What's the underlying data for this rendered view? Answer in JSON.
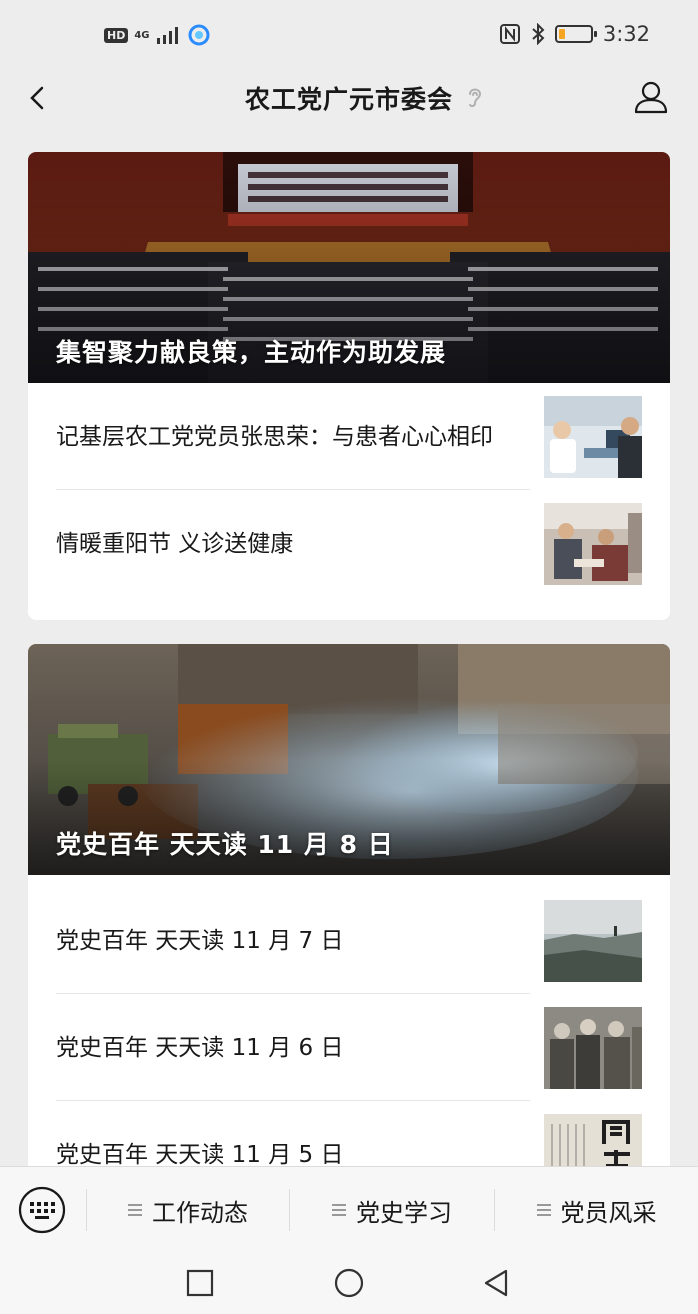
{
  "status_bar": {
    "left_badge": "HD",
    "network": "4G",
    "time": "3:32",
    "battery_level_percent": 20,
    "battery_color": "#f5a623"
  },
  "nav": {
    "title": "农工党广元市委会",
    "back_icon": "chevron-left-icon",
    "listen_icon": "ear-icon",
    "profile_icon": "person-icon"
  },
  "cards": [
    {
      "hero_title": "集智聚力献良策，主动作为助发展",
      "hero_image": "auditorium-meeting-photo",
      "items": [
        {
          "title": "记基层农工党党员张思荣：与患者心心相印",
          "thumb": "doctor-consultation-photo"
        },
        {
          "title": "情暖重阳节 义诊送健康",
          "thumb": "free-clinic-photo"
        }
      ]
    },
    {
      "hero_title": "党史百年 天天读 11 月 8 日",
      "hero_image": "construction-site-photo",
      "items": [
        {
          "title": "党史百年 天天读 11 月 7 日",
          "thumb": "historic-landscape-photo"
        },
        {
          "title": "党史百年 天天读 11 月 6 日",
          "thumb": "historic-soldiers-photo"
        },
        {
          "title": "党史百年 天天读 11 月 5 日",
          "thumb": "historic-calligraphy-photo"
        }
      ]
    }
  ],
  "menu": {
    "keyboard_icon": "keyboard-icon",
    "items": [
      {
        "label": "工作动态"
      },
      {
        "label": "党史学习"
      },
      {
        "label": "党员风采"
      }
    ]
  },
  "system_nav": {
    "recent_icon": "square-icon",
    "home_icon": "circle-icon",
    "back_icon": "triangle-back-icon"
  },
  "colors": {
    "background": "#ededed",
    "card": "#ffffff",
    "text": "#191919",
    "menu_bar": "#f7f7f7"
  }
}
